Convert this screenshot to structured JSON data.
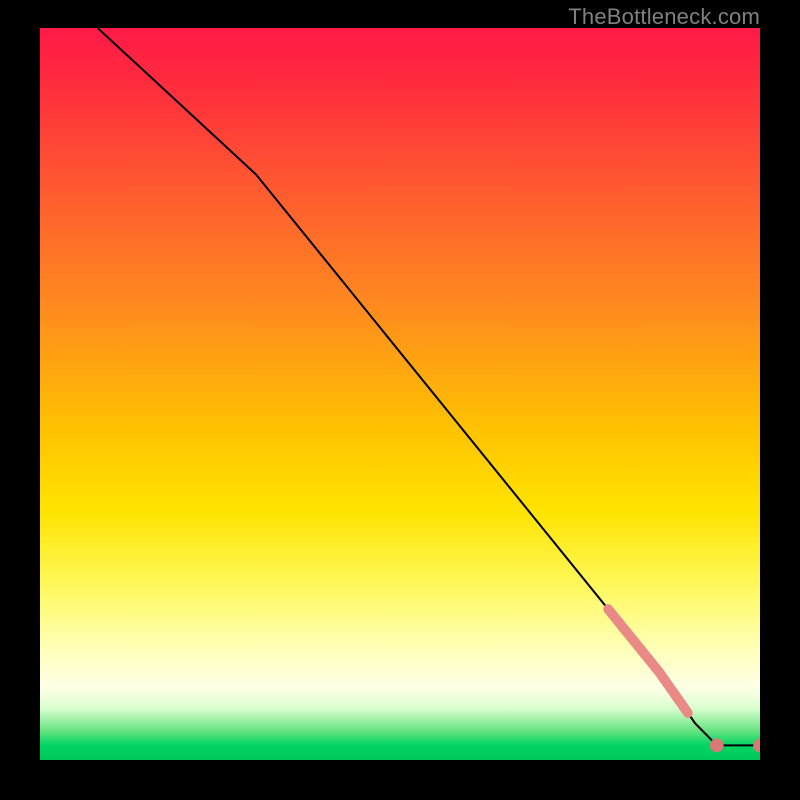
{
  "watermark": "TheBottleneck.com",
  "colors": {
    "curve_stroke": "#000000",
    "marker_fill": "#e98a86",
    "marker_stroke": "#e98a86",
    "end_marker_fill": "#d87b77",
    "background_black": "#000000"
  },
  "chart_data": {
    "type": "line",
    "title": "",
    "xlabel": "",
    "ylabel": "",
    "xlim": [
      0,
      100
    ],
    "ylim": [
      0,
      100
    ],
    "grid": false,
    "legend": false,
    "series": [
      {
        "name": "curve",
        "x": [
          8,
          30,
          86,
          91,
          94,
          100
        ],
        "y": [
          100,
          80,
          12,
          5,
          2,
          2
        ]
      }
    ],
    "marker_clusters": [
      {
        "along_x_range": [
          79,
          86
        ],
        "count": 14,
        "shape": "thick-dashes"
      },
      {
        "along_x_range": [
          86,
          90
        ],
        "count": 6,
        "shape": "thick-dashes"
      }
    ],
    "end_markers_x": [
      94,
      100
    ],
    "annotations": []
  }
}
